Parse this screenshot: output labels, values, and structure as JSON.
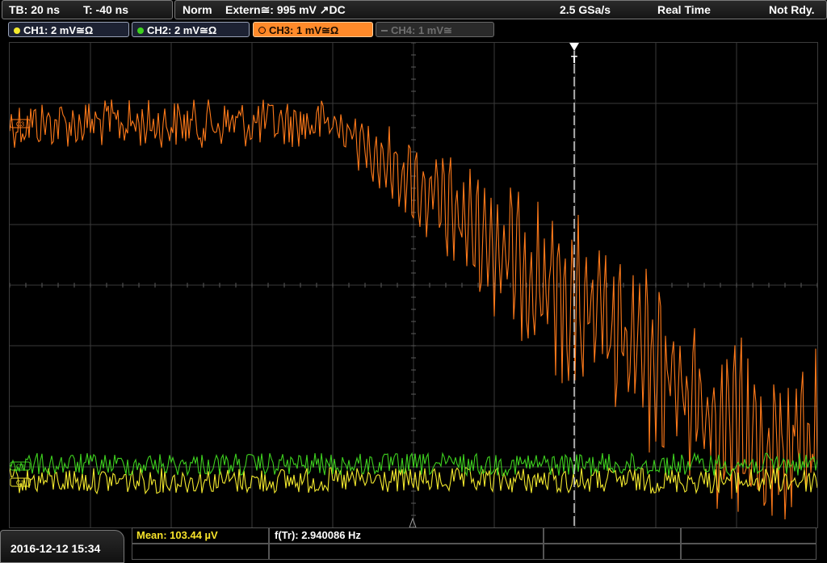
{
  "topbar": {
    "timebase": "TB: 20 ns",
    "trigger_pos": "T: -40 ns",
    "mode": "Norm",
    "trigger_source": "Extern≅: 995 mV ↗DC",
    "sample_rate": "2.5 GSa/s",
    "acq_mode": "Real Time",
    "state": "Not Rdy."
  },
  "channels": [
    {
      "label": "CH1: 2 mV≅Ω",
      "color": "#f4ea2e"
    },
    {
      "label": "CH2: 2 mV≅Ω",
      "color": "#3ed11f"
    },
    {
      "label": "CH3: 1 mV≅Ω",
      "color": "#ff7a1a"
    },
    {
      "label": "CH4: 1 mV≅",
      "color": "#6f6f6f"
    }
  ],
  "markers": {
    "ch3": "C3",
    "ch2": "C2",
    "ch1": "C1",
    "trigger": "T"
  },
  "bottom": {
    "datetime": "2016-12-12 15:34",
    "mean": "Mean: 103.44 µV",
    "freq": "f(Tr): 2.940086 Hz"
  },
  "colors": {
    "grid": "#3a3a3a",
    "ch1": "#f4ea2e",
    "ch2": "#3ed11f",
    "ch3": "#ff7a1a"
  }
}
